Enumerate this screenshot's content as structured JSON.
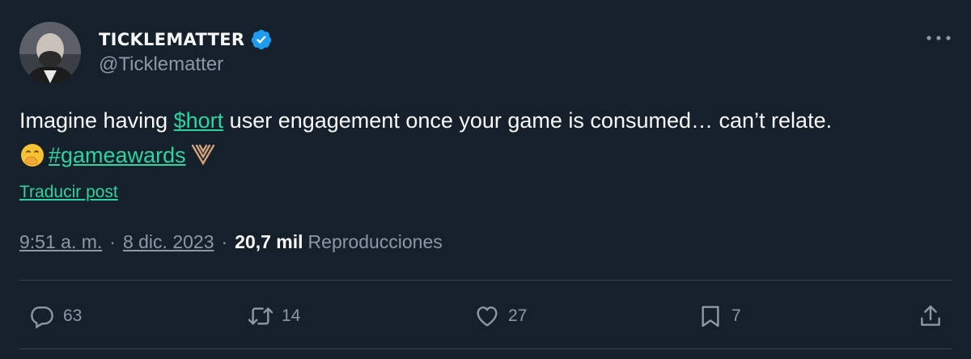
{
  "author": {
    "display_name": "TICKLEMATTER",
    "handle": "@Ticklematter",
    "verified": true
  },
  "tweet": {
    "text_before_cashtag": "Imagine having ",
    "cashtag": "$hort",
    "text_after_cashtag": " user engagement once your game is consumed… can’t relate.",
    "hashtag": "#gameawards",
    "translate_label": "Traducir post"
  },
  "meta": {
    "time": "9:51 a. m.",
    "separator": "·",
    "date": "8 dic. 2023",
    "views_count": "20,7 mil",
    "views_label": "Reproducciones"
  },
  "actions": {
    "replies": "63",
    "retweets": "14",
    "likes": "27",
    "bookmarks": "7"
  },
  "icons": {
    "verified": "verified-badge-icon",
    "more": "more-options-icon",
    "reply": "reply-icon",
    "retweet": "retweet-icon",
    "like": "heart-icon",
    "bookmark": "bookmark-icon",
    "share": "share-icon",
    "emoji_face": "hand-over-mouth-emoji",
    "emoji_logo": "game-awards-logo-emoji"
  },
  "colors": {
    "background": "#15202b",
    "link": "#2bd4a0",
    "secondary_text": "#8b98a5",
    "verified": "#1d9bf0"
  }
}
